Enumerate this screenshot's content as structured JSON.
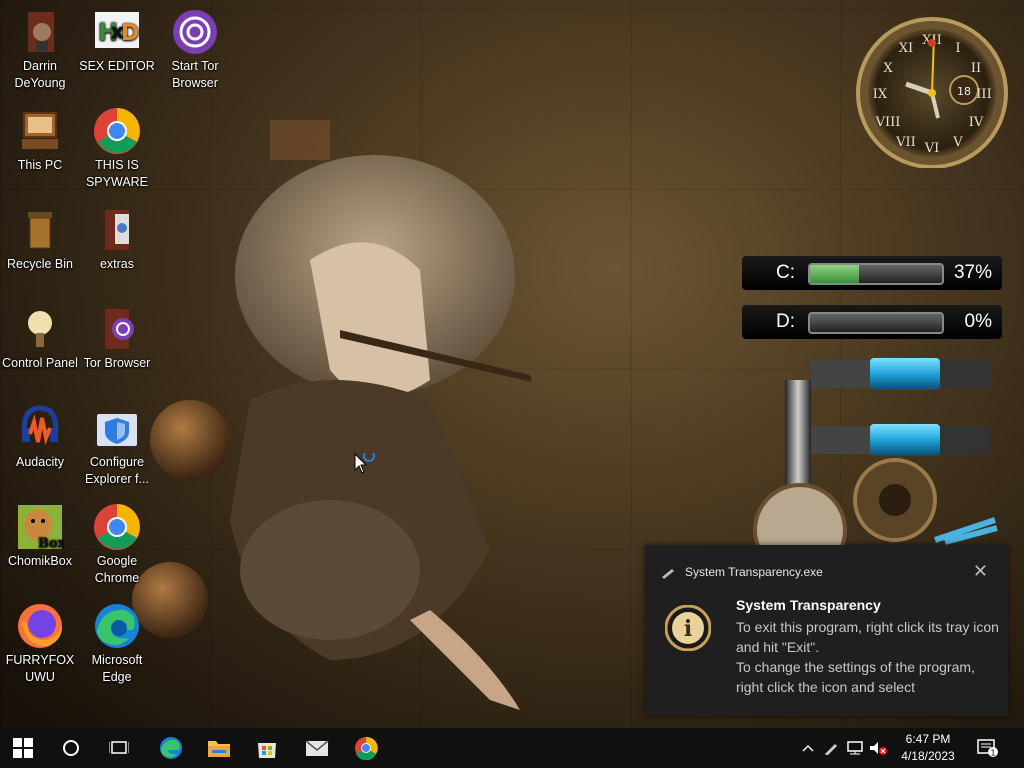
{
  "desktop_icons": [
    {
      "label": "Darrin DeYoung",
      "icon": "person-folder-icon"
    },
    {
      "label": "SEX EDITOR",
      "icon": "hex-editor-icon"
    },
    {
      "label": "Start Tor Browser",
      "icon": "tor-icon"
    },
    {
      "label": "This PC",
      "icon": "computer-icon"
    },
    {
      "label": "THIS IS SPYWARE",
      "icon": "chrome-icon"
    },
    {
      "label": "Recycle Bin",
      "icon": "recycle-bin-icon"
    },
    {
      "label": "extras",
      "icon": "folder-icon"
    },
    {
      "label": "Control Panel",
      "icon": "control-panel-icon"
    },
    {
      "label": "Tor Browser",
      "icon": "tor-folder-icon"
    },
    {
      "label": "Audacity",
      "icon": "audacity-icon"
    },
    {
      "label": "Configure Explorer f...",
      "icon": "shield-folder-icon"
    },
    {
      "label": "ChomikBox",
      "icon": "chomikbox-icon"
    },
    {
      "label": "Google Chrome",
      "icon": "chrome-icon"
    },
    {
      "label": "FURRYFOX UWU",
      "icon": "firefox-icon"
    },
    {
      "label": "Microsoft Edge",
      "icon": "edge-icon"
    }
  ],
  "clock_widget": {
    "date_day": "18"
  },
  "drives": [
    {
      "letter": "C:",
      "percent_text": "37%",
      "fraction": 0.37
    },
    {
      "letter": "D:",
      "percent_text": "0%",
      "fraction": 0.0
    }
  ],
  "notification": {
    "app_name": "System Transparency.exe",
    "close_glyph": "✕",
    "title": "System Transparency",
    "body": "To exit this program, right click its tray icon and hit \"Exit\".\nTo change the settings of the program, right click the icon and select"
  },
  "taskbar": {
    "time": "6:47 PM",
    "date": "4/18/2023",
    "notification_count": "1"
  },
  "colors": {
    "taskbar_bg": "#101010",
    "toast_bg": "#1f1f1f",
    "drive_fill": "#5cae55"
  }
}
